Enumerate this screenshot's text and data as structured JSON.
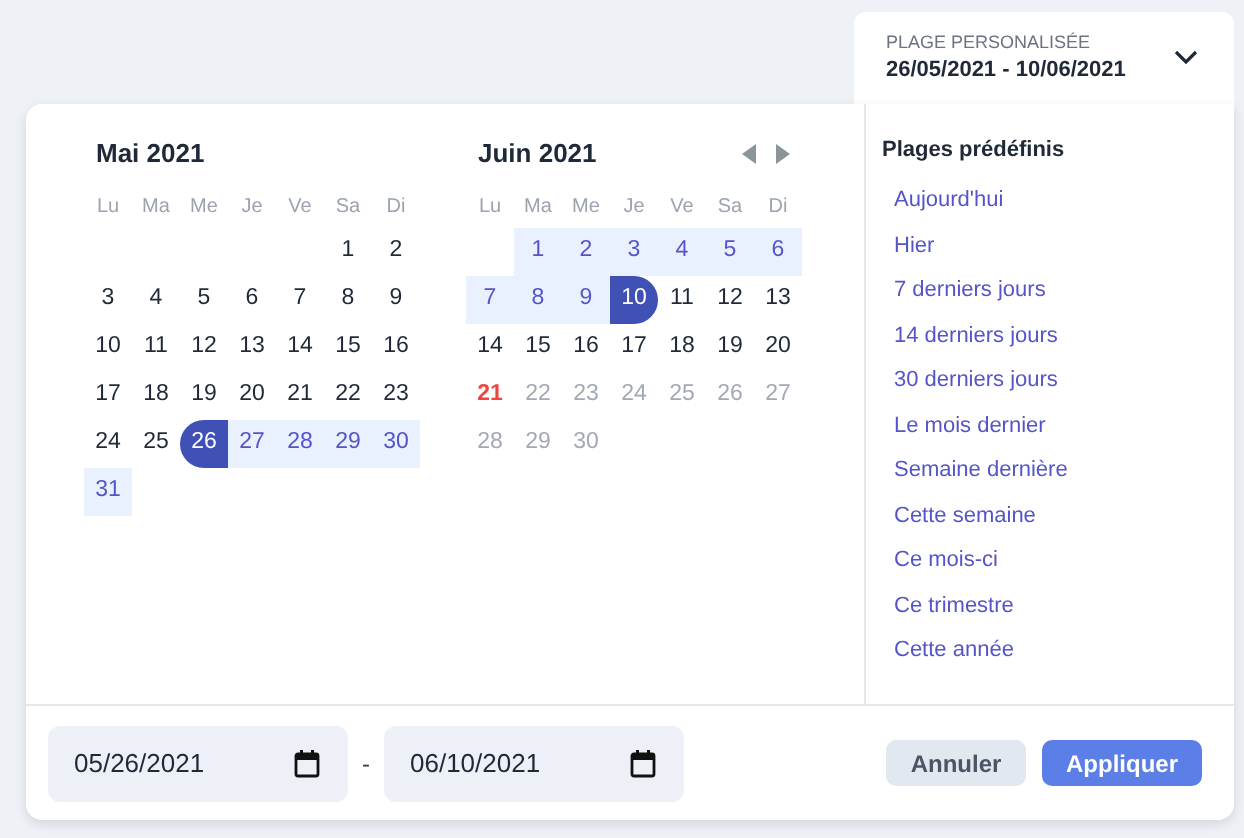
{
  "trigger": {
    "label": "PLAGE PERSONALISÉE",
    "value": "26/05/2021 - 10/06/2021"
  },
  "months": [
    {
      "title": "Mai 2021",
      "nav": false,
      "weekdays": [
        "Lu",
        "Ma",
        "Me",
        "Je",
        "Ve",
        "Sa",
        "Di"
      ],
      "weeks": [
        [
          {
            "kind": "empty"
          },
          {
            "kind": "empty"
          },
          {
            "kind": "empty"
          },
          {
            "kind": "empty"
          },
          {
            "kind": "empty"
          },
          {
            "day": "1",
            "kind": "plain"
          },
          {
            "day": "2",
            "kind": "plain"
          }
        ],
        [
          {
            "day": "3",
            "kind": "plain"
          },
          {
            "day": "4",
            "kind": "plain"
          },
          {
            "day": "5",
            "kind": "plain"
          },
          {
            "day": "6",
            "kind": "plain"
          },
          {
            "day": "7",
            "kind": "plain"
          },
          {
            "day": "8",
            "kind": "plain"
          },
          {
            "day": "9",
            "kind": "plain"
          }
        ],
        [
          {
            "day": "10",
            "kind": "plain"
          },
          {
            "day": "11",
            "kind": "plain"
          },
          {
            "day": "12",
            "kind": "plain"
          },
          {
            "day": "13",
            "kind": "plain"
          },
          {
            "day": "14",
            "kind": "plain"
          },
          {
            "day": "15",
            "kind": "plain"
          },
          {
            "day": "16",
            "kind": "plain"
          }
        ],
        [
          {
            "day": "17",
            "kind": "plain"
          },
          {
            "day": "18",
            "kind": "plain"
          },
          {
            "day": "19",
            "kind": "plain"
          },
          {
            "day": "20",
            "kind": "plain"
          },
          {
            "day": "21",
            "kind": "plain"
          },
          {
            "day": "22",
            "kind": "plain"
          },
          {
            "day": "23",
            "kind": "plain"
          }
        ],
        [
          {
            "day": "24",
            "kind": "plain"
          },
          {
            "day": "25",
            "kind": "plain"
          },
          {
            "day": "26",
            "kind": "start"
          },
          {
            "day": "27",
            "kind": "range"
          },
          {
            "day": "28",
            "kind": "range"
          },
          {
            "day": "29",
            "kind": "range"
          },
          {
            "day": "30",
            "kind": "range"
          }
        ],
        [
          {
            "day": "31",
            "kind": "range"
          }
        ]
      ]
    },
    {
      "title": "Juin 2021",
      "nav": true,
      "weekdays": [
        "Lu",
        "Ma",
        "Me",
        "Je",
        "Ve",
        "Sa",
        "Di"
      ],
      "weeks": [
        [
          {
            "kind": "empty"
          },
          {
            "day": "1",
            "kind": "range"
          },
          {
            "day": "2",
            "kind": "range"
          },
          {
            "day": "3",
            "kind": "range"
          },
          {
            "day": "4",
            "kind": "range"
          },
          {
            "day": "5",
            "kind": "range"
          },
          {
            "day": "6",
            "kind": "range"
          }
        ],
        [
          {
            "day": "7",
            "kind": "range"
          },
          {
            "day": "8",
            "kind": "range"
          },
          {
            "day": "9",
            "kind": "range"
          },
          {
            "day": "10",
            "kind": "end"
          },
          {
            "day": "11",
            "kind": "plain"
          },
          {
            "day": "12",
            "kind": "plain"
          },
          {
            "day": "13",
            "kind": "plain"
          }
        ],
        [
          {
            "day": "14",
            "kind": "plain"
          },
          {
            "day": "15",
            "kind": "plain"
          },
          {
            "day": "16",
            "kind": "plain"
          },
          {
            "day": "17",
            "kind": "plain"
          },
          {
            "day": "18",
            "kind": "plain"
          },
          {
            "day": "19",
            "kind": "plain"
          },
          {
            "day": "20",
            "kind": "plain"
          }
        ],
        [
          {
            "day": "21",
            "kind": "today"
          },
          {
            "day": "22",
            "kind": "disabled"
          },
          {
            "day": "23",
            "kind": "disabled"
          },
          {
            "day": "24",
            "kind": "disabled"
          },
          {
            "day": "25",
            "kind": "disabled"
          },
          {
            "day": "26",
            "kind": "disabled"
          },
          {
            "day": "27",
            "kind": "disabled"
          }
        ],
        [
          {
            "day": "28",
            "kind": "disabled"
          },
          {
            "day": "29",
            "kind": "disabled"
          },
          {
            "day": "30",
            "kind": "disabled"
          }
        ]
      ]
    }
  ],
  "presets": {
    "title": "Plages prédéfinis",
    "items": [
      "Aujourd'hui",
      "Hier",
      "7 derniers jours",
      "14 derniers jours",
      "30 derniers jours",
      "Le mois dernier",
      "Semaine dernière",
      "Cette semaine",
      "Ce mois-ci",
      "Ce trimestre",
      "Cette année"
    ]
  },
  "footer": {
    "start_date": {
      "value": "05/26/2021"
    },
    "separator": "-",
    "end_date": {
      "value": "06/10/2021"
    },
    "buttons": [
      {
        "label": "Annuler",
        "kind": "secondary"
      },
      {
        "label": "Appliquer",
        "kind": "primary"
      }
    ]
  }
}
